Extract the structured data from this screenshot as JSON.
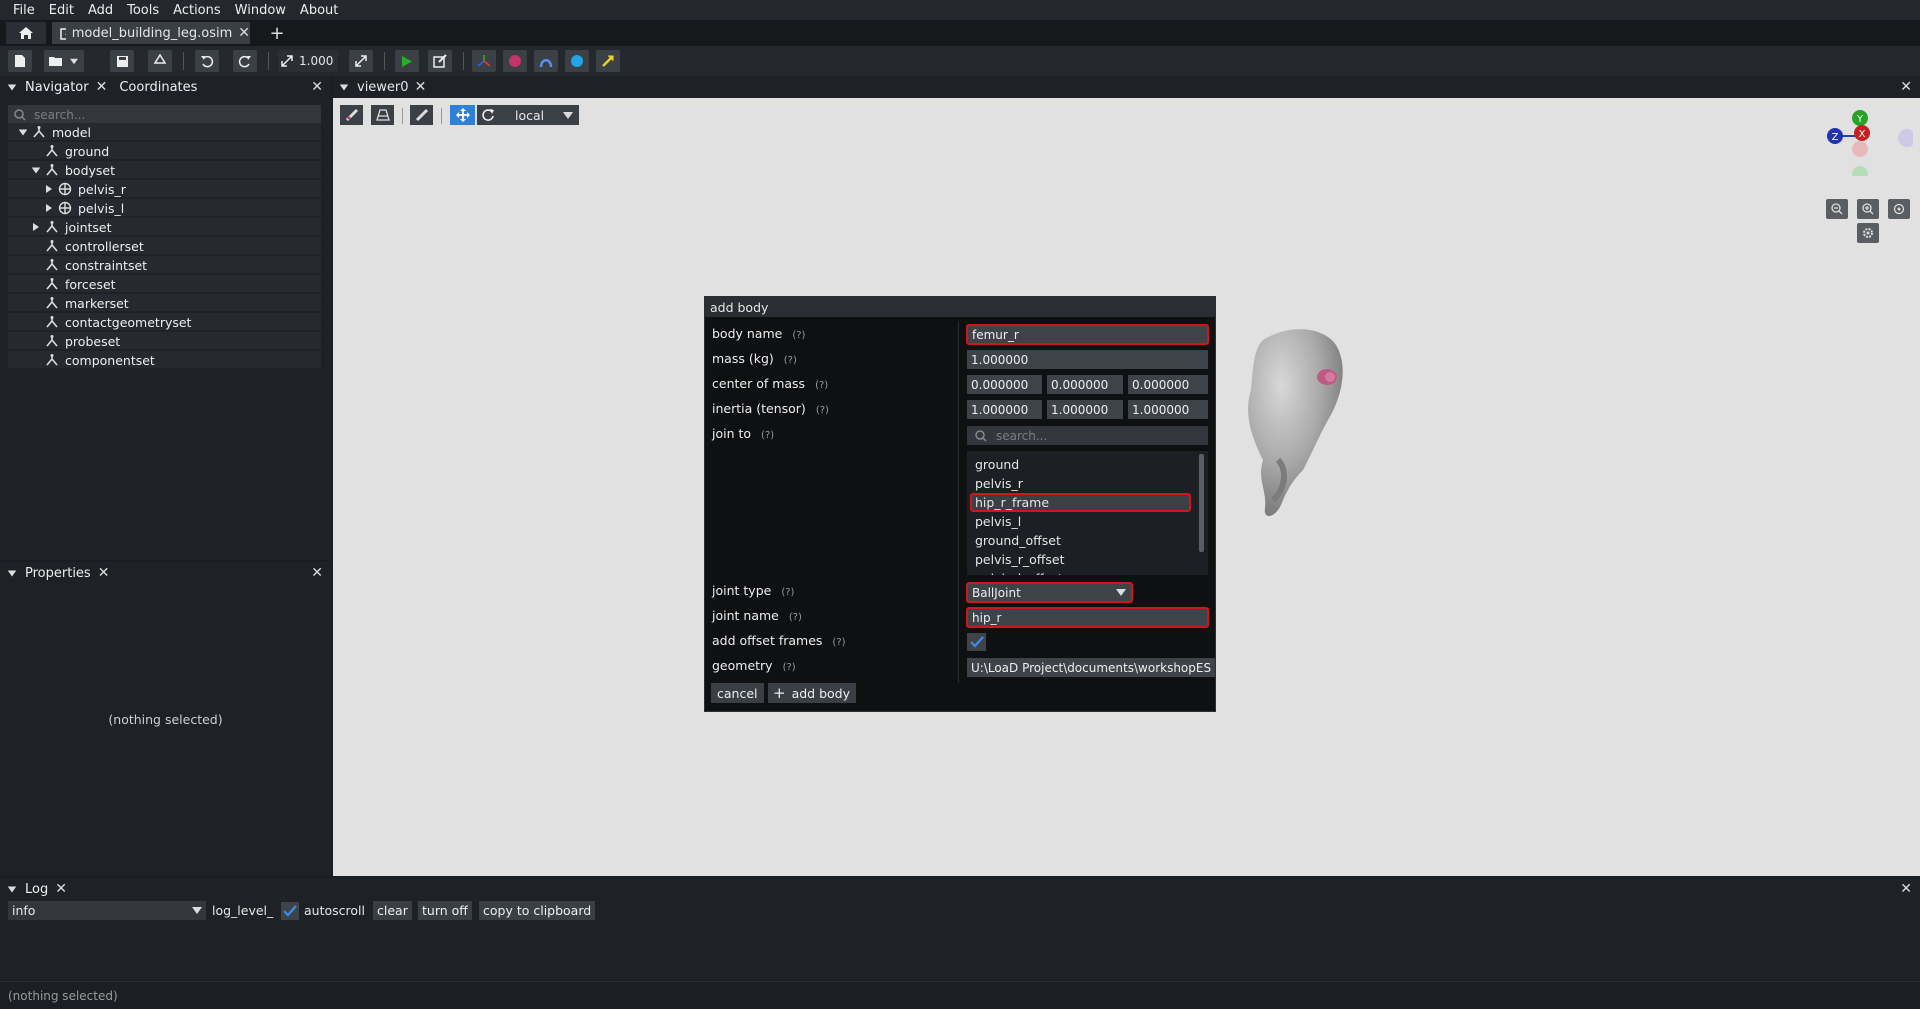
{
  "menu": [
    "File",
    "Edit",
    "Add",
    "Tools",
    "Actions",
    "Window",
    "About"
  ],
  "tab": {
    "title": "model_building_leg.osim"
  },
  "toolbar": {
    "scale_value": "1.000"
  },
  "navigator": {
    "tabs": [
      "Navigator",
      "Coordinates"
    ],
    "search_placeholder": "search...",
    "tree": [
      {
        "label": "model",
        "depth": 0,
        "expander": "open"
      },
      {
        "label": "ground",
        "depth": 1,
        "expander": "none"
      },
      {
        "label": "bodyset",
        "depth": 1,
        "expander": "open"
      },
      {
        "label": "pelvis_r",
        "depth": 2,
        "expander": "closed"
      },
      {
        "label": "pelvis_l",
        "depth": 2,
        "expander": "closed"
      },
      {
        "label": "jointset",
        "depth": 1,
        "expander": "closed"
      },
      {
        "label": "controllerset",
        "depth": 1,
        "expander": "none"
      },
      {
        "label": "constraintset",
        "depth": 1,
        "expander": "none"
      },
      {
        "label": "forceset",
        "depth": 1,
        "expander": "none"
      },
      {
        "label": "markerset",
        "depth": 1,
        "expander": "none"
      },
      {
        "label": "contactgeometryset",
        "depth": 1,
        "expander": "none"
      },
      {
        "label": "probeset",
        "depth": 1,
        "expander": "none"
      },
      {
        "label": "componentset",
        "depth": 1,
        "expander": "none"
      }
    ]
  },
  "properties": {
    "title": "Properties",
    "empty_text": "(nothing selected)"
  },
  "viewer": {
    "title": "viewer0",
    "frame_mode": "local"
  },
  "dialog": {
    "title": "add body",
    "help": "(?)",
    "labels": {
      "body_name": "body name",
      "mass": "mass (kg)",
      "center_of_mass": "center of mass",
      "inertia": "inertia (tensor)",
      "join_to": "join to",
      "joint_type": "joint type",
      "joint_name": "joint name",
      "add_offset_frames": "add offset frames",
      "geometry": "geometry"
    },
    "values": {
      "body_name": "femur_r",
      "mass": "1.000000",
      "com": [
        "0.000000",
        "0.000000",
        "0.000000"
      ],
      "inertia": [
        "1.000000",
        "1.000000",
        "1.000000"
      ],
      "join_search_placeholder": "search...",
      "join_options": [
        "ground",
        "pelvis_r",
        "hip_r_frame",
        "pelvis_l",
        "ground_offset",
        "pelvis_r_offset",
        "pelvis_l_offset"
      ],
      "joint_type": "BallJoint",
      "joint_name": "hip_r",
      "geometry": "U:\\LoaD Project\\documents\\workshopES"
    },
    "buttons": {
      "cancel": "cancel",
      "add_body": "add body"
    }
  },
  "log": {
    "title": "Log",
    "level": "info",
    "level_label": "log_level_",
    "autoscroll": "autoscroll",
    "clear": "clear",
    "turn_off": "turn off",
    "copy": "copy to clipboard"
  },
  "status": {
    "text": "(nothing selected)"
  },
  "colors": {
    "accent_blue": "#2f80d6",
    "highlight_red": "#d21616",
    "viewer_bg": "#e1e1e1"
  }
}
